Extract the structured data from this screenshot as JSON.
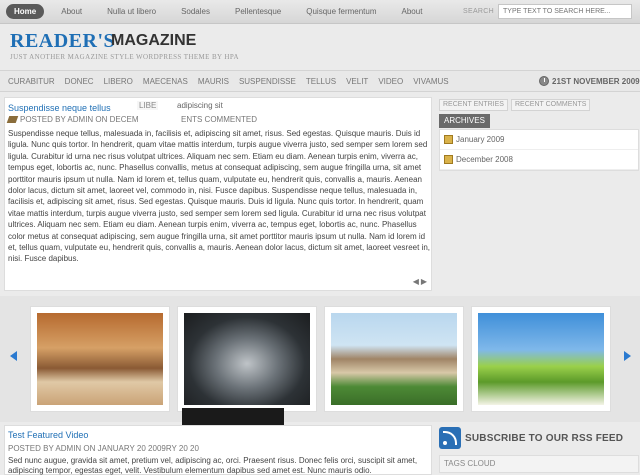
{
  "topnav": {
    "pages": [
      "Home",
      "About",
      "Nulla ut libero",
      "Sodales",
      "Pellentesque",
      "Quisque fermentum",
      "About"
    ],
    "search_label": "SEARCH",
    "search_placeholder": "TYPE TEXT TO SEARCH HERE..."
  },
  "header": {
    "logo_part1": "READER'S",
    "logo_part2": "MAGAZINE",
    "tagline": "JUST ANOTHER MAGAZINE STYLE WORDPRESS THEME BY HPA"
  },
  "categories": [
    "CURABITUR",
    "DONEC",
    "LIBERO",
    "MAECENAS",
    "MAURIS",
    "SUSPENDISSE",
    "TELLUS",
    "VELIT",
    "VIDEO",
    "VIVAMUS"
  ],
  "date": "21ST NOVEMBER 2009",
  "post": {
    "title": "Suspendisse neque tellus",
    "overlay1": "LIBE",
    "overlay2": "adipiscing sit",
    "meta": "POSTED BY ADMIN ON DECEM",
    "meta_overlay": "ENTS COMMENTED",
    "body": "Suspendisse neque tellus, malesuada in, facilisis et, adipiscing sit amet, risus. Sed egestas. Quisque mauris. Duis id ligula. Nunc quis tortor. In hendrerit, quam vitae mattis interdum, turpis augue viverra justo, sed semper sem lorem sed ligula. Curabitur id urna nec risus volutpat ultrices. Aliquam nec sem. Etiam eu diam. Aenean turpis enim, viverra ac, tempus eget, lobortis ac, nunc. Phasellus convallis, metus at consequat adipiscing, sem augue fringilla urna, sit amet porttitor mauris ipsum ut nulla. Nam id lorem et, tellus quam, vulputate eu, hendrerit quis, convallis a, mauris. Aenean dolor lacus, dictum sit amet, laoreet vel, commodo in, nisi. Fusce dapibus. Suspendisse neque tellus, malesuada in, facilisis et, adipiscing sit amet, risus. Sed egestas. Quisque mauris. Duis id ligula. Nunc quis tortor. In hendrerit, quam vitae mattis interdum, turpis augue viverra justo, sed semper sem lorem sed ligula. Curabitur id urna nec risus volutpat ultrices. Aliquam nec sem. Etiam eu diam. Aenean turpis enim, viverra ac, tempus eget, lobortis ac, nunc. Phasellus color metus at consequat adipiscing, sem augue fringilla urna, sit amet porttitor mauris ipsum ut nulla. Nam id lorem id et, tellus quam, vulputate eu, hendrerit quis, convallis a, mauris. Aenean dolor lacus, dictum sit amet, laoreet vesreet in, nisi. Fusce dapibus."
  },
  "sidebar": {
    "tab_recent_entries": "RECENT ENTRIES",
    "tab_recent_comments": "RECENT COMMENTS",
    "archives_label": "ARCHIVES",
    "archives": [
      "January 2009",
      "December 2008"
    ]
  },
  "carousel": {
    "images": [
      "living-room-photo",
      "suv-car-photo",
      "house-photo",
      "daisy-field-photo"
    ]
  },
  "post2": {
    "title": "Test Featured Video",
    "meta": "POSTED BY ADMIN ON JANUARY 20 2009RY 20 20",
    "body": "Sed nunc augue, gravida sit amet, pretium vel, adipiscing ac, orci. Praesent risus. Donec felis orci, suscipit sit amet, adipiscing tempor, egestas eget, velit. Vestibulum elementum dapibus sed amet est. Nunc mauris odio."
  },
  "rss": {
    "label": "SUBSCRIBE TO OUR RSS FEED"
  },
  "tagcloud": {
    "label": "TAGS CLOUD"
  },
  "colors": {
    "accent": "#1f6fb5",
    "arrow": "#2a7ad0",
    "active_tab": "#5a5a5a"
  }
}
